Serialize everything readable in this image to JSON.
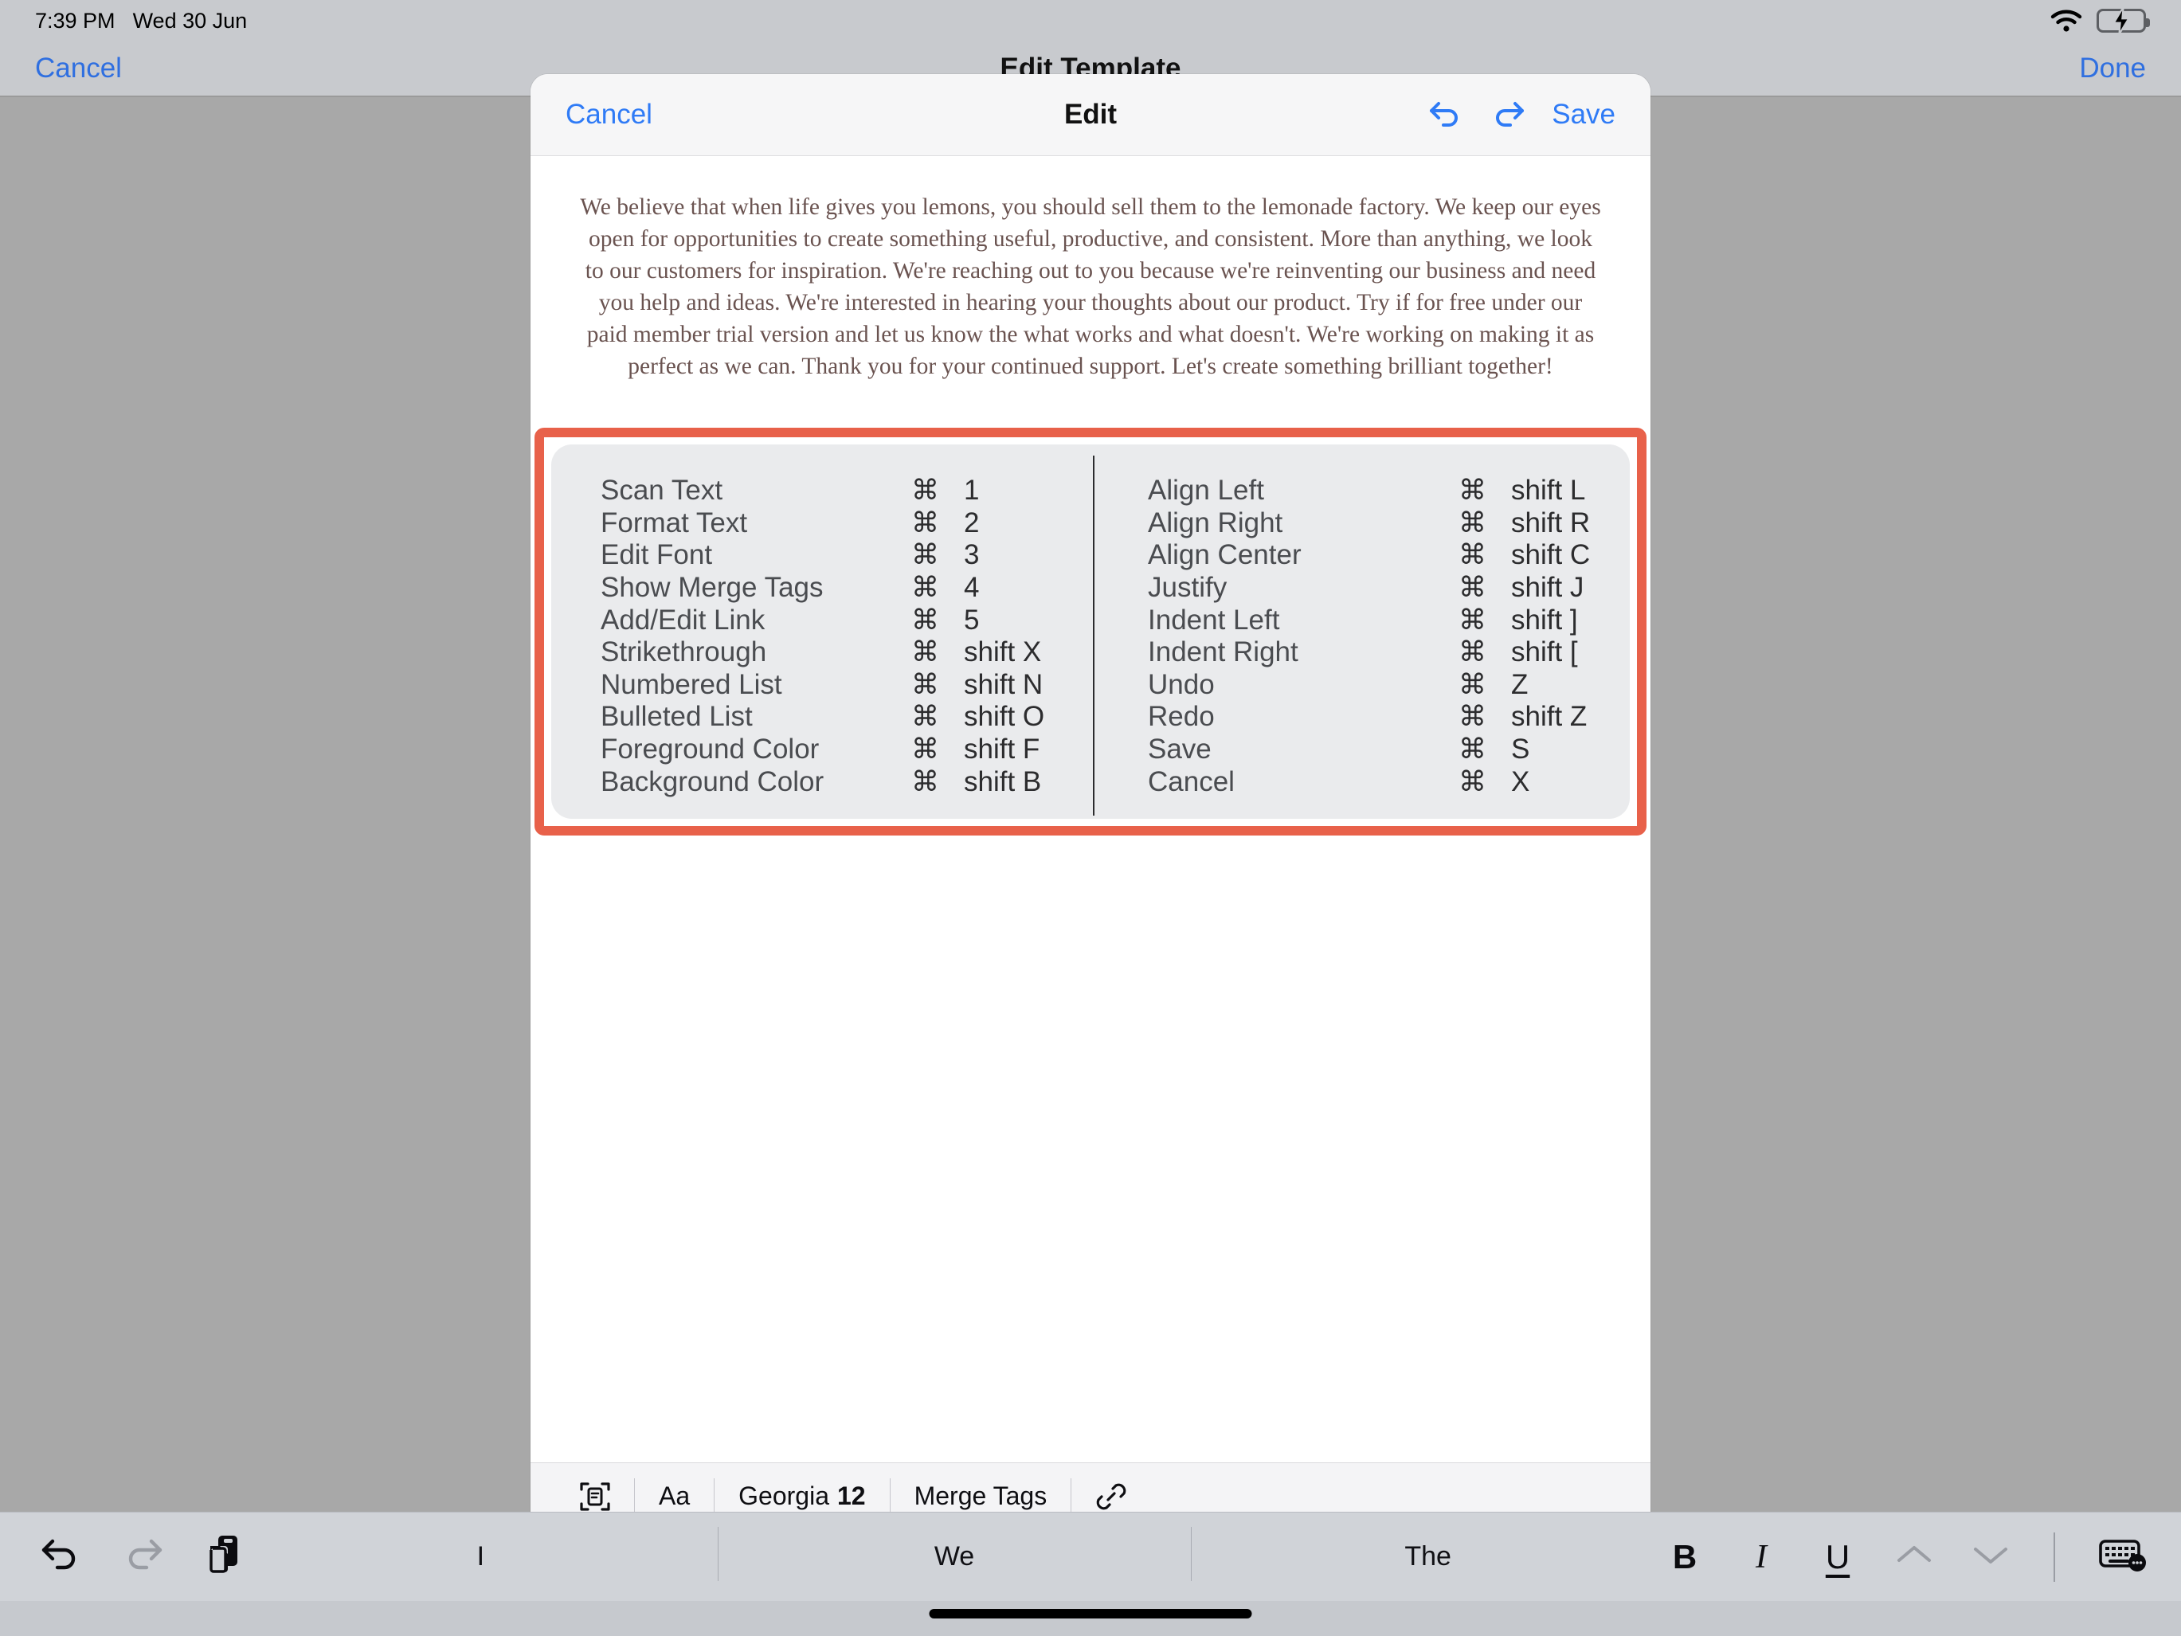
{
  "status_bar": {
    "time": "7:39 PM",
    "date": "Wed 30 Jun",
    "wifi_icon": "wifi-icon",
    "battery_icon": "battery-charging-icon"
  },
  "nav_bar": {
    "cancel_label": "Cancel",
    "title": "Edit Template",
    "done_label": "Done"
  },
  "modal": {
    "cancel_label": "Cancel",
    "title": "Edit",
    "undo_icon": "undo-arrow-icon",
    "redo_icon": "redo-arrow-icon",
    "save_label": "Save"
  },
  "document": {
    "body": "We believe that when life gives you lemons, you should sell them to the lemonade factory. We keep our eyes open for opportunities to create something useful, productive, and consistent. More than anything, we look to our customers for inspiration. We're reaching out to you because we're reinventing our business and need you help and ideas. We're interested in hearing your thoughts about our product. Try if for free under our paid member trial version and let us know the what works and what doesn't. We're working on making it as perfect as we can. Thank you for your continued support. Let's create something brilliant together!"
  },
  "shortcuts_panel": {
    "highlight_color": "#e8614a",
    "command_symbol": "⌘",
    "left_column": [
      {
        "label": "Scan Text",
        "modifier": "⌘",
        "key": "1"
      },
      {
        "label": "Format Text",
        "modifier": "⌘",
        "key": "2"
      },
      {
        "label": "Edit Font",
        "modifier": "⌘",
        "key": "3"
      },
      {
        "label": "Show Merge Tags",
        "modifier": "⌘",
        "key": "4"
      },
      {
        "label": "Add/Edit Link",
        "modifier": "⌘",
        "key": "5"
      },
      {
        "label": "Strikethrough",
        "modifier": "⌘",
        "key": "shift X"
      },
      {
        "label": "Numbered List",
        "modifier": "⌘",
        "key": "shift N"
      },
      {
        "label": "Bulleted List",
        "modifier": "⌘",
        "key": "shift O"
      },
      {
        "label": "Foreground Color",
        "modifier": "⌘",
        "key": "shift F"
      },
      {
        "label": "Background Color",
        "modifier": "⌘",
        "key": "shift B"
      }
    ],
    "right_column": [
      {
        "label": "Align Left",
        "modifier": "⌘",
        "key": "shift L"
      },
      {
        "label": "Align Right",
        "modifier": "⌘",
        "key": "shift R"
      },
      {
        "label": "Align Center",
        "modifier": "⌘",
        "key": "shift C"
      },
      {
        "label": "Justify",
        "modifier": "⌘",
        "key": "shift J"
      },
      {
        "label": "Indent Left",
        "modifier": "⌘",
        "key": "shift ]"
      },
      {
        "label": "Indent Right",
        "modifier": "⌘",
        "key": "shift ["
      },
      {
        "label": "Undo",
        "modifier": "⌘",
        "key": "Z"
      },
      {
        "label": "Redo",
        "modifier": "⌘",
        "key": "shift Z"
      },
      {
        "label": "Save",
        "modifier": "⌘",
        "key": "S"
      },
      {
        "label": "Cancel",
        "modifier": "⌘",
        "key": "X"
      }
    ]
  },
  "editor_toolbar": {
    "scan_icon": "scan-document-icon",
    "text_style_label": "Aa",
    "font_name": "Georgia",
    "font_size": "12",
    "merge_tags_label": "Merge Tags",
    "link_icon": "link-icon"
  },
  "keyboard_bar": {
    "undo_icon": "undo-arrow-icon",
    "redo_icon": "redo-arrow-icon",
    "paste_icon": "paste-icon",
    "predictions": [
      "I",
      "We",
      "The"
    ],
    "bold_label": "B",
    "italic_label": "I",
    "underline_label": "U",
    "chevron_up_icon": "chevron-up-icon",
    "chevron_down_icon": "chevron-down-icon",
    "keyboard_icon": "keyboard-dismiss-icon"
  }
}
